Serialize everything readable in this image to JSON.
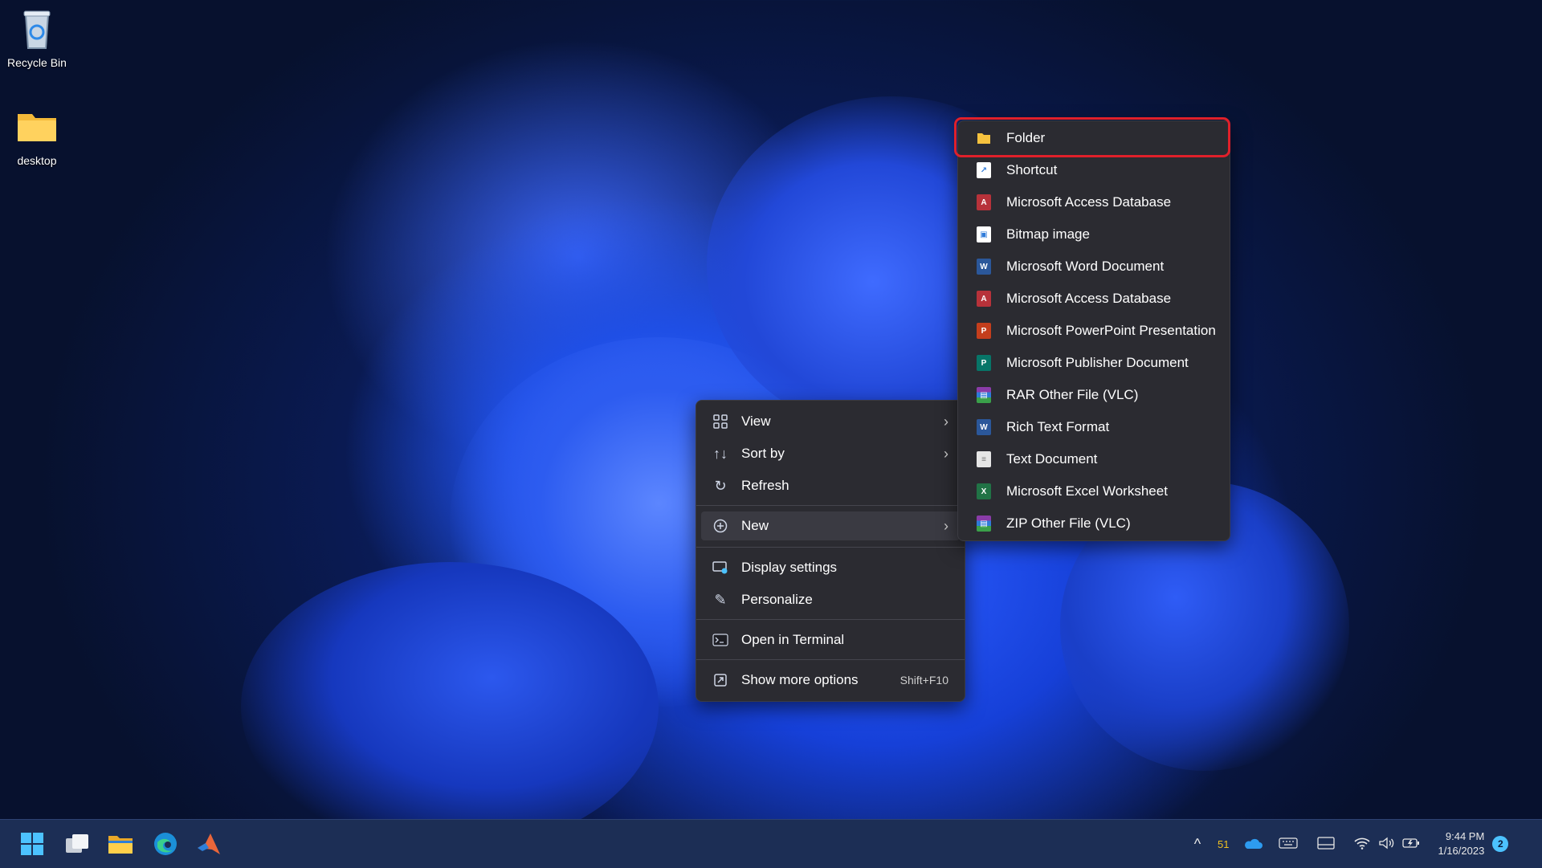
{
  "desktop": {
    "icons": [
      {
        "label": "Recycle Bin",
        "icon": "recycle-bin-icon"
      },
      {
        "label": "desktop",
        "icon": "folder-icon"
      }
    ]
  },
  "context_menu": {
    "items": [
      {
        "label": "View",
        "icon": "grid-icon",
        "has_submenu": true
      },
      {
        "label": "Sort by",
        "icon": "sort-icon",
        "has_submenu": true
      },
      {
        "label": "Refresh",
        "icon": "refresh-icon"
      },
      {
        "label": "New",
        "icon": "plus-circle-icon",
        "has_submenu": true,
        "selected": true
      },
      {
        "label": "Display settings",
        "icon": "display-icon"
      },
      {
        "label": "Personalize",
        "icon": "pen-icon"
      },
      {
        "label": "Open in Terminal",
        "icon": "terminal-icon"
      },
      {
        "label": "Show more options",
        "icon": "expand-icon",
        "shortcut": "Shift+F10"
      }
    ],
    "chevron": "›"
  },
  "new_submenu": {
    "items": [
      {
        "label": "Folder",
        "icon": "folder-icon",
        "color": "#f6c23e"
      },
      {
        "label": "Shortcut",
        "icon": "shortcut-icon",
        "color": "#2f7bd9"
      },
      {
        "label": "Microsoft Access Database",
        "icon": "access-icon",
        "color": "#b7323a"
      },
      {
        "label": "Bitmap image",
        "icon": "bitmap-icon",
        "color": "#2f7bd9"
      },
      {
        "label": "Microsoft Word Document",
        "icon": "word-icon",
        "color": "#2b579a"
      },
      {
        "label": "Microsoft Access Database",
        "icon": "access-icon",
        "color": "#b7323a"
      },
      {
        "label": "Microsoft PowerPoint Presentation",
        "icon": "powerpoint-icon",
        "color": "#c43e1c"
      },
      {
        "label": "Microsoft Publisher Document",
        "icon": "publisher-icon",
        "color": "#077568"
      },
      {
        "label": "RAR Other File (VLC)",
        "icon": "rar-icon",
        "color": "#8a3ca8"
      },
      {
        "label": "Rich Text Format",
        "icon": "rtf-icon",
        "color": "#2b579a"
      },
      {
        "label": "Text Document",
        "icon": "text-doc-icon",
        "color": "#e6e6e6"
      },
      {
        "label": "Microsoft Excel Worksheet",
        "icon": "excel-icon",
        "color": "#217346"
      },
      {
        "label": "ZIP Other File (VLC)",
        "icon": "zip-icon",
        "color": "#8a3ca8"
      }
    ]
  },
  "taskbar": {
    "apps": [
      "start-icon",
      "task-view-icon",
      "file-explorer-icon",
      "edge-icon",
      "matlab-icon"
    ],
    "tray": {
      "overflow": "^",
      "temp_badge": "51",
      "time": "9:44 PM",
      "date": "1/16/2023",
      "notifications": "2"
    }
  },
  "colors": {
    "menu_bg": "#2b2b31",
    "highlight": "#e0202a",
    "taskbar_bg": "#1c2e55",
    "accent": "#4cc2ff"
  }
}
